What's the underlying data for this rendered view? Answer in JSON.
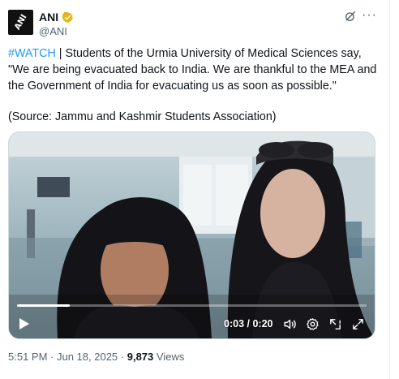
{
  "author": {
    "name": "ANI",
    "handle": "@ANI",
    "logo_text": "ANI"
  },
  "tweet": {
    "hashtag": "#WATCH",
    "body": " | Students of the Urmia University of Medical Sciences say, \"We are being evacuated back to India. We are thankful to the MEA and the Government of India for evacuating us as soon as possible.\"",
    "source": "(Source: Jammu and Kashmir Students Association)"
  },
  "video": {
    "current_time": "0:03",
    "separator": " / ",
    "duration": "0:20",
    "progress": 0.15
  },
  "meta": {
    "time": "5:51 PM",
    "dot": " · ",
    "date": "Jun 18, 2025",
    "dot2": " · ",
    "views": "9,873",
    "views_label": " Views"
  },
  "colors": {
    "accent": "#1d9bf0",
    "verified": "#e2b719",
    "muted": "#536471"
  }
}
